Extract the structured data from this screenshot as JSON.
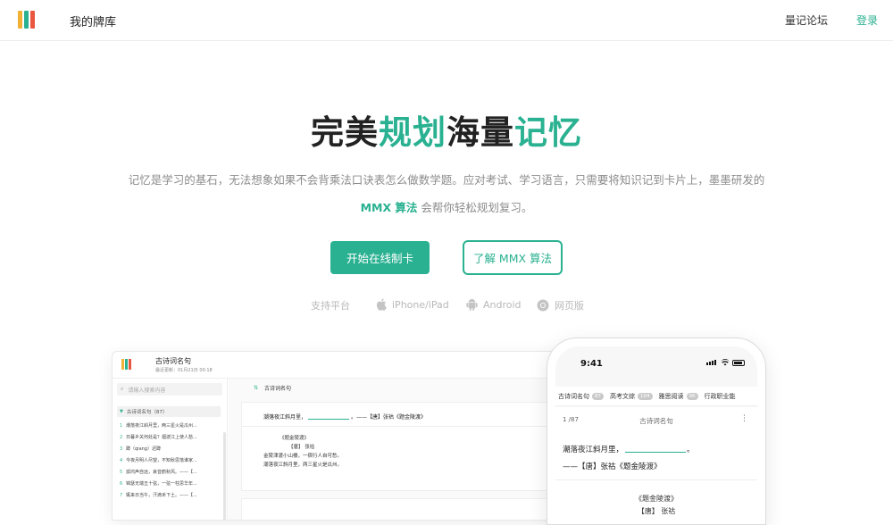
{
  "header": {
    "brand": "我的牌库",
    "nav_forum": "量记论坛",
    "nav_login": "登录",
    "logo_colors": [
      "#f2b134",
      "#2ab191",
      "#e9573f"
    ]
  },
  "hero": {
    "title_parts": [
      "完美",
      "规划",
      "海量",
      "记忆"
    ],
    "description_line1": "记忆是学习的基石，无法想象如果不会背乘法口诀表怎么做数学题。应对考试、学习语言，只需要将知识记到卡片上，墨墨研发的",
    "description_algo": "MMX 算法",
    "description_line2_rest": "会帮你轻松规划复习。",
    "primary_button": "开始在线制卡",
    "secondary_button": "了解 MMX 算法"
  },
  "platforms": {
    "label": "支持平台",
    "items": [
      {
        "name": "iPhone/iPad",
        "icon": "apple-icon"
      },
      {
        "name": "Android",
        "icon": "android-icon"
      },
      {
        "name": "网页版",
        "icon": "chrome-icon"
      }
    ]
  },
  "desktop": {
    "deck_name": "古诗词名句",
    "updated": "最近更新：01月21日 00:18",
    "search_placeholder": "请输入搜索内容",
    "tree_head": "古诗词名句（87）",
    "items": [
      {
        "n": "1",
        "text": "潮落夜江斜月里，两三星火是瓜州..."
      },
      {
        "n": "2",
        "text": "日暮乡关何处是？烟波江上使人愁..."
      },
      {
        "n": "3",
        "text": "蹲（qiang）迟蹲"
      },
      {
        "n": "4",
        "text": "今夜月明人尽望，不知秋思落谁家..."
      },
      {
        "n": "5",
        "text": "孤鸿声自远，哀音鹤秋风。——【..."
      },
      {
        "n": "6",
        "text": "锦瑟无端五十弦，一弦一柱思华年..."
      },
      {
        "n": "7",
        "text": "辄来日当午，汗滴禾下土。——【..."
      }
    ],
    "crumb": "古诗词名句",
    "card_question_before": "潮落夜江斜月里，",
    "card_question_after": "。——【唐】张祜《题金陵渡》",
    "answer_lines": [
      "《题金陵渡》",
      "【唐】  张祜",
      "金陵津渡小山楼，一宿行人自可愁。",
      "潮落夜江斜月里，两三星火是瓜州。"
    ]
  },
  "phone": {
    "time": "9:41",
    "tabs": [
      {
        "label": "古诗词名句",
        "count": "87"
      },
      {
        "label": "高考文综",
        "count": "104"
      },
      {
        "label": "雅思阅读",
        "count": "96"
      },
      {
        "label": "行政职业能",
        "count": ""
      }
    ],
    "position": "1 /87",
    "title": "古诗词名句",
    "more": "⋮",
    "question_before": "潮落夜江斜月里，",
    "question_after": "。",
    "source": "——【唐】张祜《题金陵渡》",
    "poem_title": "《题金陵渡》",
    "poem_author": "【唐】  张祜"
  },
  "colors": {
    "accent": "#2ab191",
    "text": "#222222",
    "muted": "#8c8c8c"
  }
}
